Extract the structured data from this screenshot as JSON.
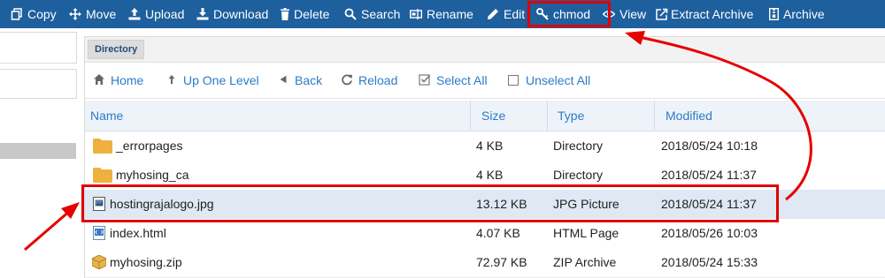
{
  "toolbar": {
    "items": [
      {
        "label": "Copy",
        "icon": "copy-icon"
      },
      {
        "label": "Move",
        "icon": "move-icon"
      },
      {
        "label": "Upload",
        "icon": "upload-icon"
      },
      {
        "label": "Download",
        "icon": "download-icon"
      },
      {
        "label": "Delete",
        "icon": "trash-icon"
      },
      {
        "label": "Search",
        "icon": "search-icon"
      },
      {
        "label": "Rename",
        "icon": "rename-icon"
      },
      {
        "label": "Edit",
        "icon": "pencil-icon"
      },
      {
        "label": "chmod",
        "icon": "key-icon"
      },
      {
        "label": "View",
        "icon": "eye-icon"
      },
      {
        "label": "Extract Archive",
        "icon": "extract-icon"
      },
      {
        "label": "Archive",
        "icon": "archive-icon"
      }
    ]
  },
  "directory_tab": "Directory",
  "nav": {
    "home": "Home",
    "up_one_level": "Up One Level",
    "back": "Back",
    "reload": "Reload",
    "select_all": "Select All",
    "unselect_all": "Unselect All"
  },
  "table": {
    "headers": {
      "name": "Name",
      "size": "Size",
      "type": "Type",
      "modified": "Modified"
    },
    "rows": [
      {
        "name": "_errorpages",
        "size": "4 KB",
        "type": "Directory",
        "modified": "2018/05/24 10:18",
        "icon": "folder-icon"
      },
      {
        "name": "myhosing_ca",
        "size": "4 KB",
        "type": "Directory",
        "modified": "2018/05/24 11:37",
        "icon": "folder-icon"
      },
      {
        "name": "hostingrajalogo.jpg",
        "size": "13.12 KB",
        "type": "JPG Picture",
        "modified": "2018/05/24 11:37",
        "icon": "image-file-icon",
        "selected": true
      },
      {
        "name": "index.html",
        "size": "4.07 KB",
        "type": "HTML Page",
        "modified": "2018/05/26 10:03",
        "icon": "html-file-icon"
      },
      {
        "name": "myhosing.zip",
        "size": "72.97 KB",
        "type": "ZIP Archive",
        "modified": "2018/05/24 15:33",
        "icon": "zip-file-icon"
      }
    ]
  },
  "colors": {
    "toolbar_bg": "#1e5f9e",
    "link": "#2c7bc7",
    "highlight": "#e00000",
    "selected_row": "#dfe8f3"
  }
}
